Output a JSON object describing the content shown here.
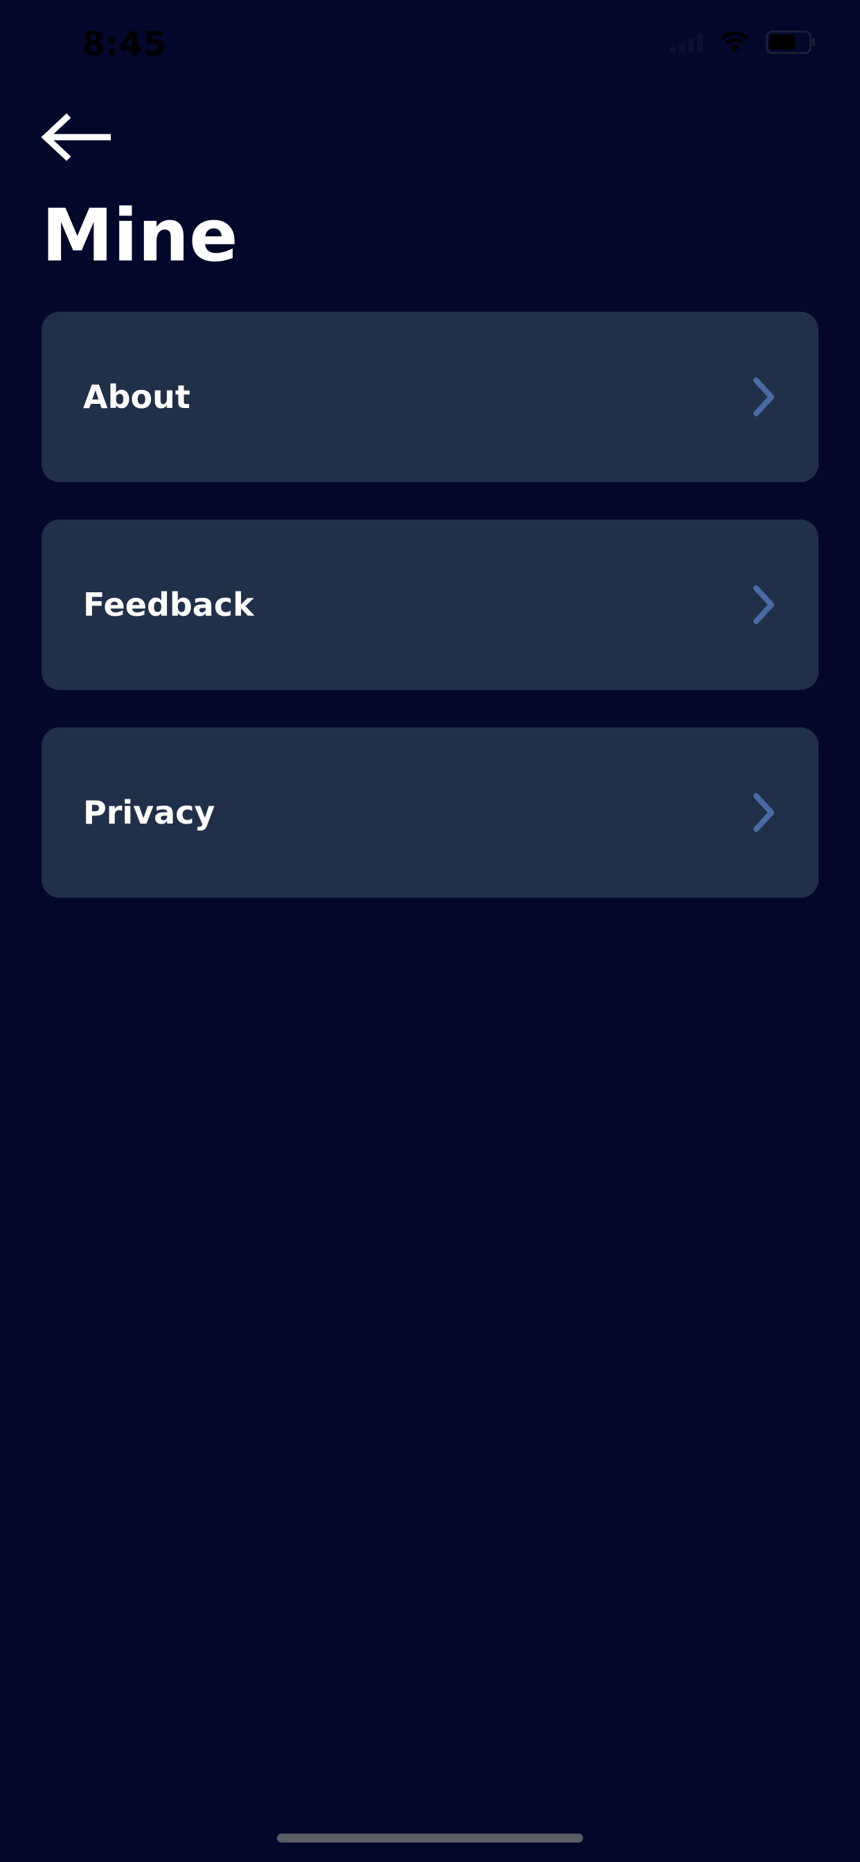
{
  "status_bar": {
    "time": "8:45",
    "icons": [
      "signal-icon",
      "wifi-icon",
      "battery-icon"
    ]
  },
  "header": {
    "back_icon": "arrow-left-icon",
    "title": "Mine"
  },
  "menu": {
    "items": [
      {
        "label": "About",
        "icon": "chevron-right-icon"
      },
      {
        "label": "Feedback",
        "icon": "chevron-right-icon"
      },
      {
        "label": "Privacy",
        "icon": "chevron-right-icon"
      }
    ]
  },
  "colors": {
    "background": "#03082B",
    "card": "#213049",
    "text": "#FFFFFF",
    "chevron": "#4B6AA6",
    "home_indicator": "#5A5C66"
  }
}
